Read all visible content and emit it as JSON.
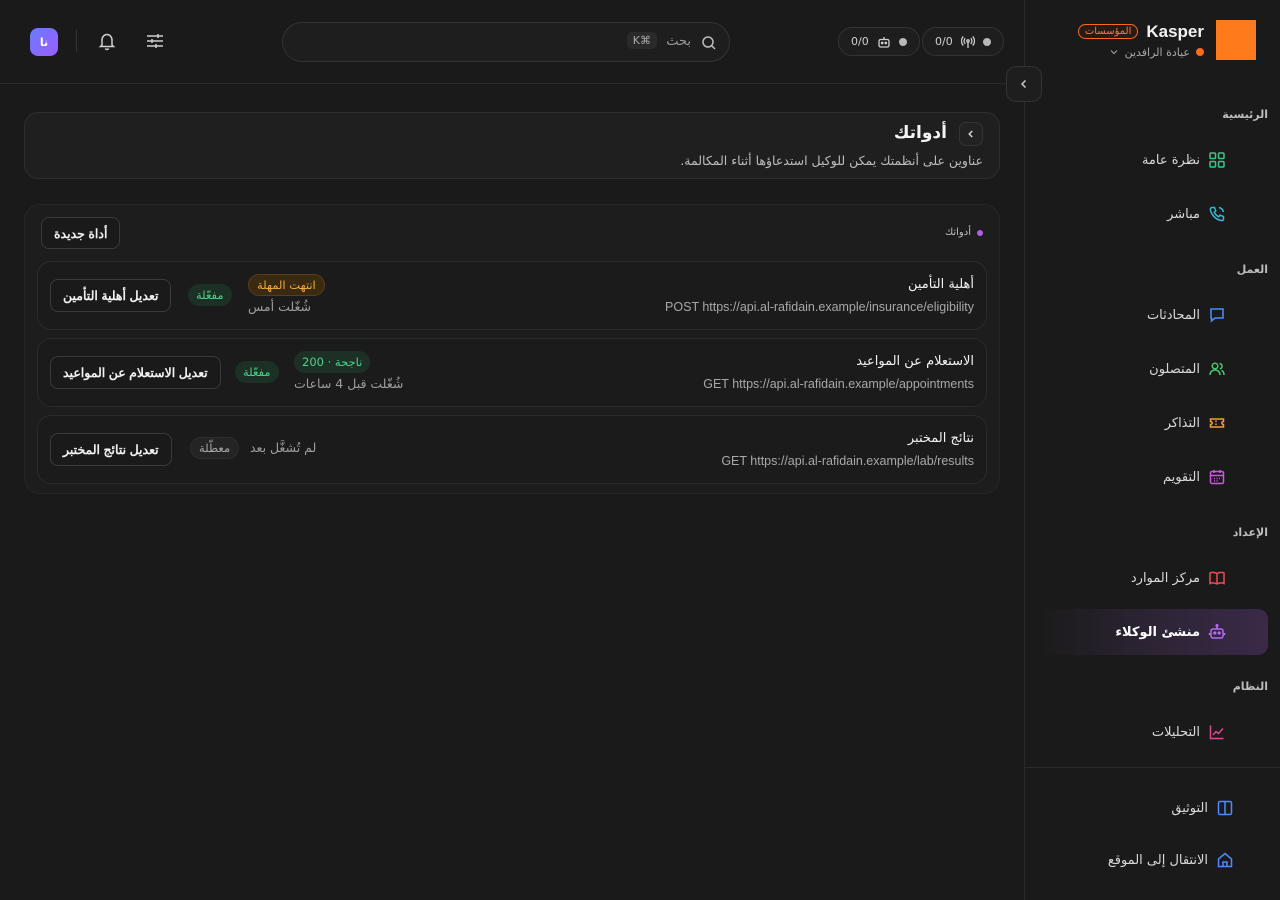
{
  "brand": {
    "name": "Kasper",
    "badge": "المؤسسات",
    "org": "عيادة الرافدين",
    "accent": "#ff7a1a"
  },
  "topbar": {
    "counters": [
      {
        "icon": "antenna-icon",
        "value": "0/0"
      },
      {
        "icon": "bot-icon",
        "value": "0/0"
      }
    ],
    "search": {
      "placeholder": "بحث",
      "shortcut": "⌘K"
    },
    "avatar_initials": "نا"
  },
  "sidebar": {
    "sections": [
      {
        "label": "الرئيسية",
        "items": [
          {
            "label": "نظرة عامة",
            "icon": "grid-icon",
            "color": "#3ec48a"
          },
          {
            "label": "مباشر",
            "icon": "phone-icon",
            "color": "#38b6d6"
          }
        ]
      },
      {
        "label": "العمل",
        "items": [
          {
            "label": "المحادثات",
            "icon": "chat-icon",
            "color": "#4a8cff"
          },
          {
            "label": "المتصلون",
            "icon": "users-icon",
            "color": "#48c76a"
          },
          {
            "label": "التذاكر",
            "icon": "ticket-icon",
            "color": "#f0a03a"
          },
          {
            "label": "التقويم",
            "icon": "calendar-icon",
            "color": "#c65cd6"
          }
        ]
      },
      {
        "label": "الإعداد",
        "items": [
          {
            "label": "مركز الموارد",
            "icon": "book-icon",
            "color": "#f04a5a"
          },
          {
            "label": "منشئ الوكلاء",
            "icon": "bot-icon",
            "color": "#b46cf0",
            "active": true
          }
        ]
      },
      {
        "label": "النظام",
        "items": [
          {
            "label": "التحليلات",
            "icon": "chart-icon",
            "color": "#e04a8a"
          }
        ]
      }
    ],
    "footer": [
      {
        "label": "التوثيق",
        "icon": "book-open-icon",
        "color": "#4a8cff"
      },
      {
        "label": "الانتقال إلى الموقع",
        "icon": "home-icon",
        "color": "#4a8cff"
      }
    ]
  },
  "page": {
    "title": "أدواتك",
    "subtitle": "عناوين على أنظمتك يمكن للوكيل استدعاؤها أثناء المكالمة."
  },
  "tools_panel": {
    "label": "أدواتك",
    "new_button": "أداة جديدة",
    "tools": [
      {
        "name": "أهلية التأمين",
        "endpoint": "POST https://api.al-rafidain.example/insurance/eligibility",
        "status": "مفعّلة",
        "result": "انتهت المهلة",
        "last_run": "شُغّلت أمس",
        "edit_label": "تعديل أهلية التأمين"
      },
      {
        "name": "الاستعلام عن المواعيد",
        "endpoint": "GET https://api.al-rafidain.example/appointments",
        "status": "مفعّلة",
        "result": "ناجحة · 200",
        "last_run": "شُغّلت قبل 4 ساعات",
        "edit_label": "تعديل الاستعلام عن المواعيد"
      },
      {
        "name": "نتائج المختبر",
        "endpoint": "GET https://api.al-rafidain.example/lab/results",
        "status": "معطّلة",
        "result": "",
        "last_run": "لم تُشغَّل بعد",
        "edit_label": "تعديل نتائج المختبر"
      }
    ]
  }
}
